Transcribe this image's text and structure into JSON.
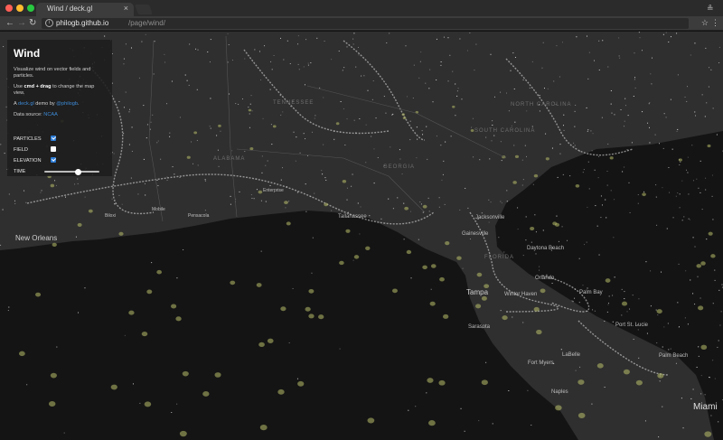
{
  "browser": {
    "tab_title": "Wind / deck.gl",
    "tab_close": "×",
    "url_host": "philogb.github.io",
    "url_path": "/page/wind/",
    "back": "←",
    "forward": "→",
    "reload": "↻",
    "star": "☆",
    "menu": "⋮",
    "info": "i",
    "profile": "≗"
  },
  "panel": {
    "title": "Wind",
    "description": "Visualize wind on vector fields and particles.",
    "instruction_pre": "Use ",
    "instruction_keys": "cmd + drag",
    "instruction_post": " to change the map view.",
    "credit_pre": "A ",
    "credit_link": "deck.gl",
    "credit_mid": " demo by ",
    "credit_author": "@philogb",
    "credit_post": ".",
    "source_label": "Data source: ",
    "source_link": "NCAA",
    "controls": [
      {
        "label": "PARTICLES",
        "checked": true
      },
      {
        "label": "FIELD",
        "checked": false
      },
      {
        "label": "ELEVATION",
        "checked": true
      }
    ],
    "time_label": "TIME",
    "time_value": 0.62
  },
  "map": {
    "cities": [
      {
        "name": "New Orleans",
        "size": "big"
      },
      {
        "name": "Tallahassee",
        "size": "normal"
      },
      {
        "name": "Jacksonville",
        "size": "normal"
      },
      {
        "name": "Gainesville",
        "size": "normal"
      },
      {
        "name": "Daytona Beach",
        "size": "normal"
      },
      {
        "name": "Orlando",
        "size": "normal"
      },
      {
        "name": "Tampa",
        "size": "big"
      },
      {
        "name": "Winter Haven",
        "size": "normal"
      },
      {
        "name": "Palm Bay",
        "size": "normal"
      },
      {
        "name": "Sarasota",
        "size": "normal"
      },
      {
        "name": "Port St. Lucie",
        "size": "normal"
      },
      {
        "name": "LaBelle",
        "size": "normal"
      },
      {
        "name": "Palm Beach",
        "size": "normal"
      },
      {
        "name": "Fort Myers",
        "size": "normal"
      },
      {
        "name": "Naples",
        "size": "normal"
      },
      {
        "name": "Miami",
        "size": "xl"
      },
      {
        "name": "Biloxi",
        "size": "small"
      },
      {
        "name": "Mobile",
        "size": "small"
      },
      {
        "name": "Pensacola",
        "size": "small"
      },
      {
        "name": "Enterprise",
        "size": "small"
      }
    ],
    "states": [
      "ALABAMA",
      "GEORGIA",
      "FLORIDA",
      "NORTH CAROLINA",
      "SOUTH CAROLINA",
      "TENNESSEE"
    ],
    "colors": {
      "land": "#2f2f2f",
      "water": "#141414",
      "particle": "#ffffff",
      "elevation": "#b9bf6a"
    }
  }
}
